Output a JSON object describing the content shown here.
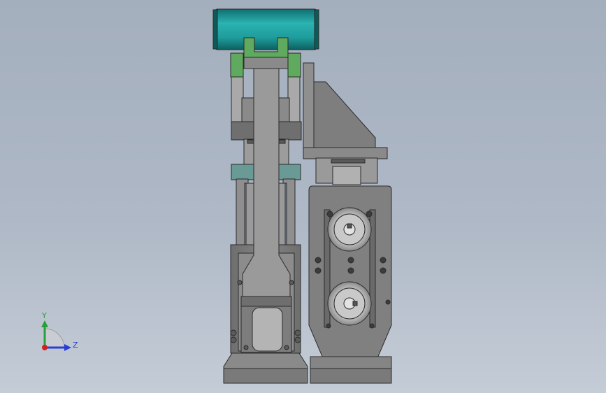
{
  "viewport": {
    "background_top": "#a4afbd",
    "background_bottom": "#c4ccd6"
  },
  "part_colors": {
    "body_gray": "#7d7d7d",
    "light_gray": "#a9a9a9",
    "dark_gray": "#4f4f4f",
    "roller_teal": "#1f9c9c",
    "bracket_green": "#5faa5f",
    "block_teal": "#6a9a96",
    "rail_blue": "#7c8fb3",
    "edge": "#2b2b2b"
  },
  "triad": {
    "y_label": "Y",
    "z_label": "Z",
    "y_color": "#27a03a",
    "z_color": "#2a3ed0",
    "origin_color": "#d21f1f"
  },
  "icons": {
    "triad": "coordinate-triad-icon"
  }
}
